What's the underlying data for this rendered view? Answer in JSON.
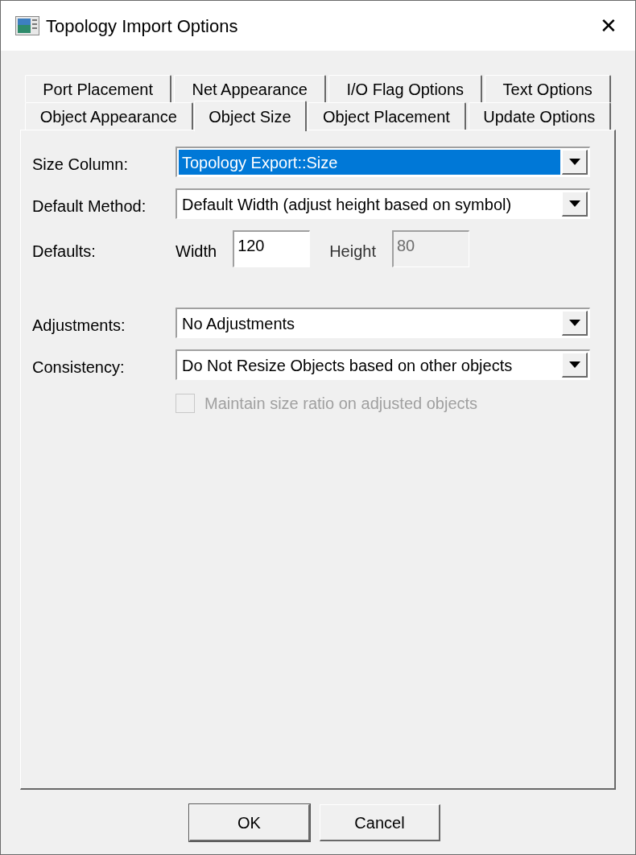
{
  "window": {
    "title": "Topology Import Options",
    "close": "✕"
  },
  "tab_rows": [
    [
      {
        "label": "Port Placement",
        "selected": false
      },
      {
        "label": "Net Appearance",
        "selected": false
      },
      {
        "label": "I/O Flag Options",
        "selected": false
      },
      {
        "label": "Text Options",
        "selected": false
      }
    ],
    [
      {
        "label": "Object Appearance",
        "selected": false
      },
      {
        "label": "Object Size",
        "selected": true
      },
      {
        "label": "Object Placement",
        "selected": false
      },
      {
        "label": "Update Options",
        "selected": false
      }
    ]
  ],
  "groups": [
    [
      {
        "kind": "combo",
        "label": "Size Column:",
        "value": "Topology Export::Size",
        "focused": true
      },
      {
        "kind": "combo",
        "label": "Default Method:",
        "value": "Default Width (adjust height based on symbol)",
        "focused": false
      },
      {
        "kind": "pair",
        "label": "Defaults:",
        "fields": [
          {
            "label": "Width",
            "value": "120",
            "disabled": false
          },
          {
            "label": "Height",
            "value": "80",
            "disabled": true
          }
        ]
      }
    ],
    [
      {
        "kind": "combo",
        "label": "Adjustments:",
        "value": "No Adjustments",
        "focused": false
      },
      {
        "kind": "combo",
        "label": "Consistency:",
        "value": "Do Not Resize Objects based on other objects",
        "focused": false
      },
      {
        "kind": "checkbox",
        "label": "Maintain size ratio on adjusted objects",
        "checked": false,
        "disabled": true
      }
    ]
  ],
  "buttons": [
    {
      "label": "OK",
      "default": true
    },
    {
      "label": "Cancel",
      "default": false
    }
  ]
}
